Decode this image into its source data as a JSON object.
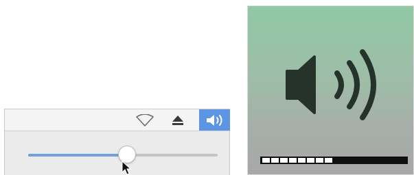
{
  "menubar": {
    "icons": [
      {
        "name": "wifi-icon",
        "active": false
      },
      {
        "name": "eject-icon",
        "active": false
      },
      {
        "name": "volume-icon",
        "active": true
      }
    ],
    "active_color": "#5b95e3"
  },
  "volume_menu": {
    "slider_level": 0.52,
    "track_fill_color": "#6fa1dc"
  },
  "hud": {
    "icon": "speaker-high-volume-icon",
    "segments_total": 16,
    "segments_filled": 8
  }
}
